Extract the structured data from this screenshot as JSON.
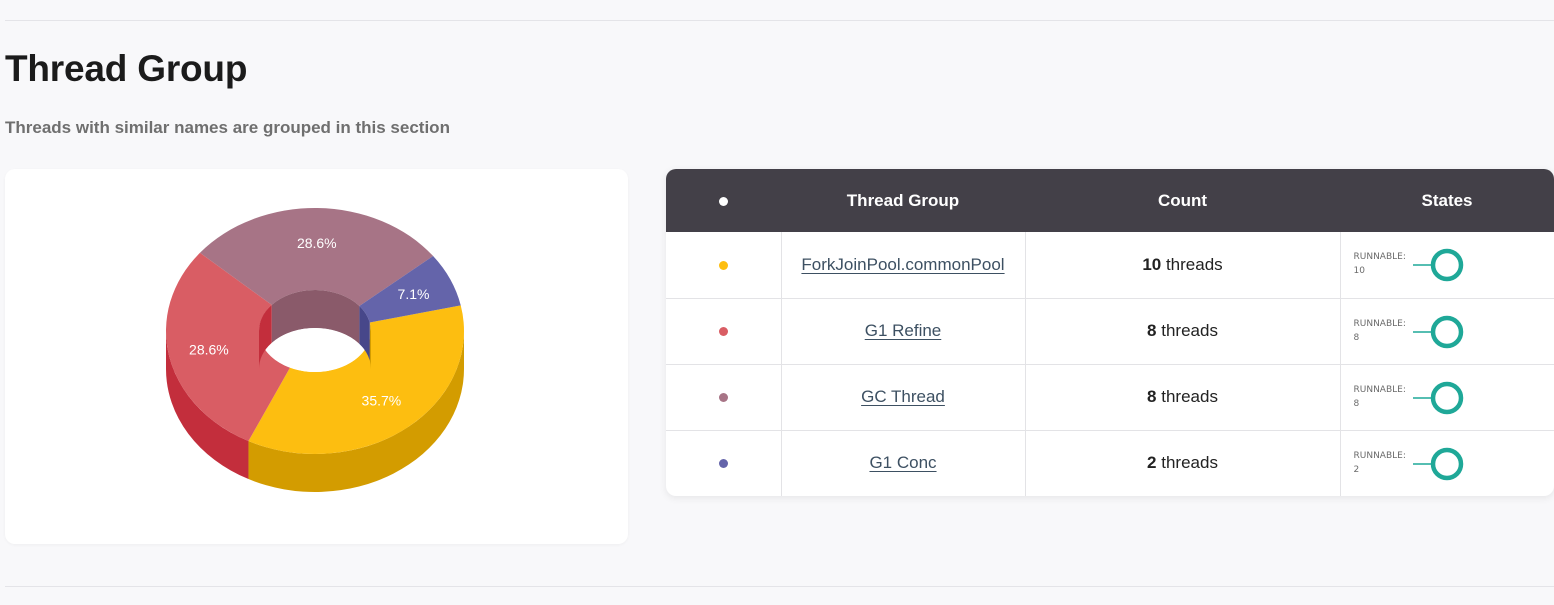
{
  "section": {
    "title": "Thread Group",
    "subtitle": "Threads with similar names are grouped in this section"
  },
  "table": {
    "headers": {
      "dot": "●",
      "group": "Thread Group",
      "count": "Count",
      "states": "States"
    },
    "rows": [
      {
        "name": "ForkJoinPool.commonPool",
        "count": "10",
        "unit": " threads",
        "color": "#fdbe10",
        "state_label": "RUNNABLE:",
        "state_count": "10"
      },
      {
        "name": "G1 Refine",
        "count": "8",
        "unit": " threads",
        "color": "#d95d64",
        "state_label": "RUNNABLE:",
        "state_count": "8"
      },
      {
        "name": "GC Thread",
        "count": "8",
        "unit": " threads",
        "color": "#a77486",
        "state_label": "RUNNABLE:",
        "state_count": "8"
      },
      {
        "name": "G1 Conc",
        "count": "2",
        "unit": " threads",
        "color": "#6464aa",
        "state_label": "RUNNABLE:",
        "state_count": "2"
      }
    ],
    "state_color": "#1fa898"
  },
  "chart_data": {
    "type": "pie",
    "variant": "donut-3d",
    "slices": [
      {
        "category": "ForkJoinPool.commonPool",
        "value": 35.7,
        "label": "35.7%",
        "color": "#fdbe10",
        "side_color": "#d39c00"
      },
      {
        "category": "G1 Refine",
        "value": 28.6,
        "label": "28.6%",
        "color": "#d95d64",
        "side_color": "#c32e3c"
      },
      {
        "category": "GC Thread",
        "value": 28.6,
        "label": "28.6%",
        "color": "#a77486",
        "side_color": "#8a5a6a"
      },
      {
        "category": "G1 Conc",
        "value": 7.1,
        "label": "7.1%",
        "color": "#6464aa",
        "side_color": "#47478a"
      }
    ]
  }
}
